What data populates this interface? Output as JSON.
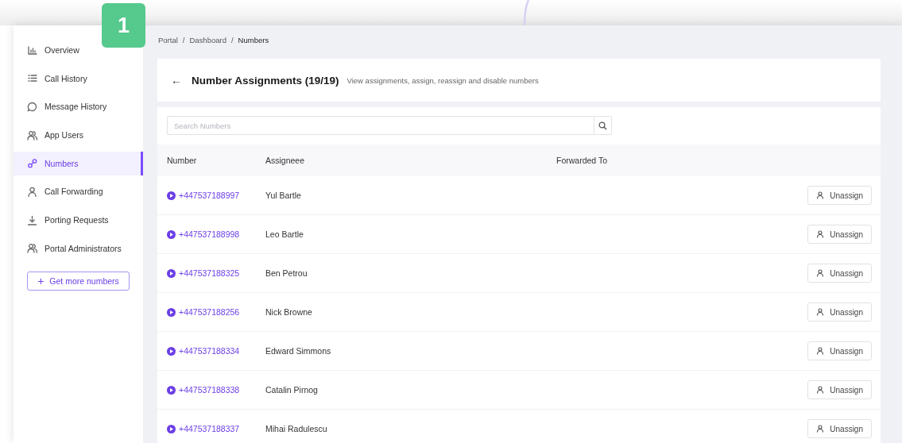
{
  "step_badge": "1",
  "sidebar": {
    "items": [
      {
        "label": "Overview",
        "selected": false
      },
      {
        "label": "Call History",
        "selected": false
      },
      {
        "label": "Message History",
        "selected": false
      },
      {
        "label": "App Users",
        "selected": false
      },
      {
        "label": "Numbers",
        "selected": true
      },
      {
        "label": "Call Forwarding",
        "selected": false
      },
      {
        "label": "Porting Requests",
        "selected": false
      },
      {
        "label": "Portal Administrators",
        "selected": false
      }
    ],
    "action_button": {
      "icon_text": "+",
      "label": "Get more numbers"
    }
  },
  "breadcrumb": [
    "Portal",
    "Dashboard",
    "Numbers"
  ],
  "breadcrumb_separator": "/",
  "header": {
    "back": "←",
    "title": "Number Assignments (19/19)",
    "subtitle": "View assignments, assign, reassign and disable numbers"
  },
  "search": {
    "placeholder": "Search Numbers"
  },
  "table": {
    "columns": [
      "Number",
      "Assigneee",
      "Forwarded To"
    ],
    "rows": [
      {
        "number": "+447537188997",
        "assignee": "Yul Bartle",
        "action": "Unassign"
      },
      {
        "number": "+447537188998",
        "assignee": "Leo Bartle",
        "action": "Unassign"
      },
      {
        "number": "+447537188325",
        "assignee": "Ben Petrou",
        "action": "Unassign"
      },
      {
        "number": "+447537188256",
        "assignee": "Nick Browne",
        "action": "Unassign"
      },
      {
        "number": "+447537188334",
        "assignee": "Edward Simmons",
        "action": "Unassign"
      },
      {
        "number": "+447537188338",
        "assignee": "Catalin Pirnog",
        "action": "Unassign"
      },
      {
        "number": "+447537188337",
        "assignee": "Mihai Radulescu",
        "action": "Unassign"
      }
    ]
  }
}
